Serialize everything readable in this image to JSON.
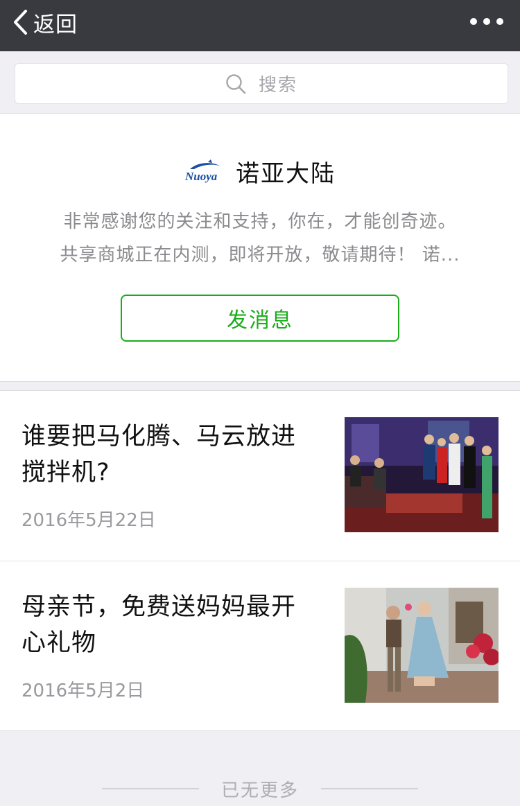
{
  "nav": {
    "back_label": "返回",
    "more_icon": "more-icon"
  },
  "search": {
    "placeholder": "搜索",
    "icon": "search-icon"
  },
  "profile": {
    "logo_text": "Nuoya",
    "name": "诺亚大陆",
    "intro_line1": "非常感谢您的关注和支持，你在，才能创奇迹。",
    "intro_line2": "共享商城正在内测，即将开放，敬请期待！ 诺...",
    "message_button": "发消息",
    "accent_color": "#1aad19"
  },
  "articles": [
    {
      "title": "谁要把马化腾、马云放进搅拌机?",
      "date": "2016年5月22日",
      "thumbnail": "tv-show-stage-photo"
    },
    {
      "title": "母亲节，免费送妈妈最开心礼物",
      "date": "2016年5月2日",
      "thumbnail": "mother-and-child-flower-photo"
    }
  ],
  "footer": {
    "no_more": "已无更多"
  }
}
